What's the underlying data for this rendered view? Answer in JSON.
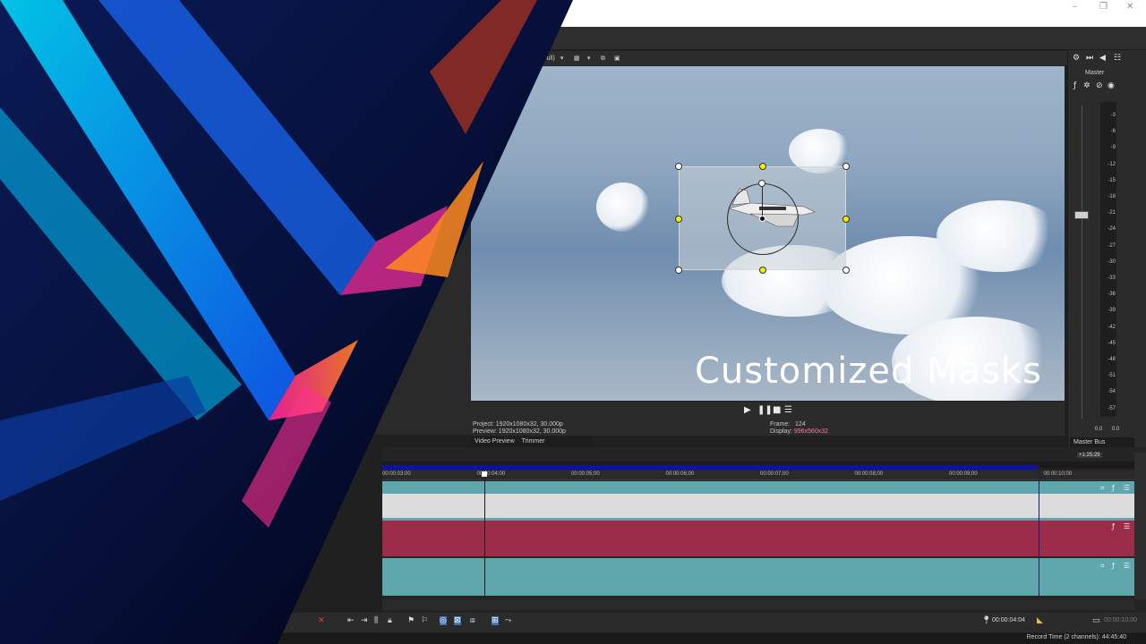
{
  "window": {
    "minimize_icon": "minimize-icon",
    "restore_icon": "restore-icon",
    "close_icon": "close-icon"
  },
  "preview_toolbar": {
    "quality_label": "t (Full)"
  },
  "preview": {
    "overlay_text": "Customized Masks"
  },
  "transport": {
    "project_label": "Project:",
    "project_value": "1920x1080x32, 30.000p",
    "preview_label": "Preview:",
    "preview_value": "1920x1080x32, 30.000p",
    "frame_label": "Frame:",
    "frame_value": "124",
    "display_label": "Display:",
    "display_value": "996x560x32"
  },
  "tabs": {
    "video_preview": "Video Preview",
    "trimmer": "Trimmer",
    "master_bus": "Master Bus"
  },
  "master": {
    "label": "Master",
    "db_scale": [
      "3",
      "6",
      "9",
      "12",
      "15",
      "18",
      "21",
      "24",
      "27",
      "30",
      "33",
      "36",
      "39",
      "42",
      "45",
      "48",
      "51",
      "54",
      "57"
    ],
    "left_level": "0.0",
    "right_level": "0.0"
  },
  "timeline": {
    "ticks": [
      "00:00:03;00",
      "00:00:04;00",
      "00:00:05;00",
      "00:00:06;00",
      "00:00:07;00",
      "00:00:08;00",
      "00:00:09;00",
      "00:00:10;00"
    ],
    "flag": "+1:25:29",
    "cursor_time": "00:00:04:04",
    "end_time": "00:00:10:00"
  },
  "status": {
    "record_time": "Record Time (2 channels): 44:45:40"
  },
  "colors": {
    "teal_track": "#5fa7ad",
    "red_track": "#9b2d4a",
    "loop_bar": "#1010a8",
    "handle_yellow": "#f4f000"
  }
}
